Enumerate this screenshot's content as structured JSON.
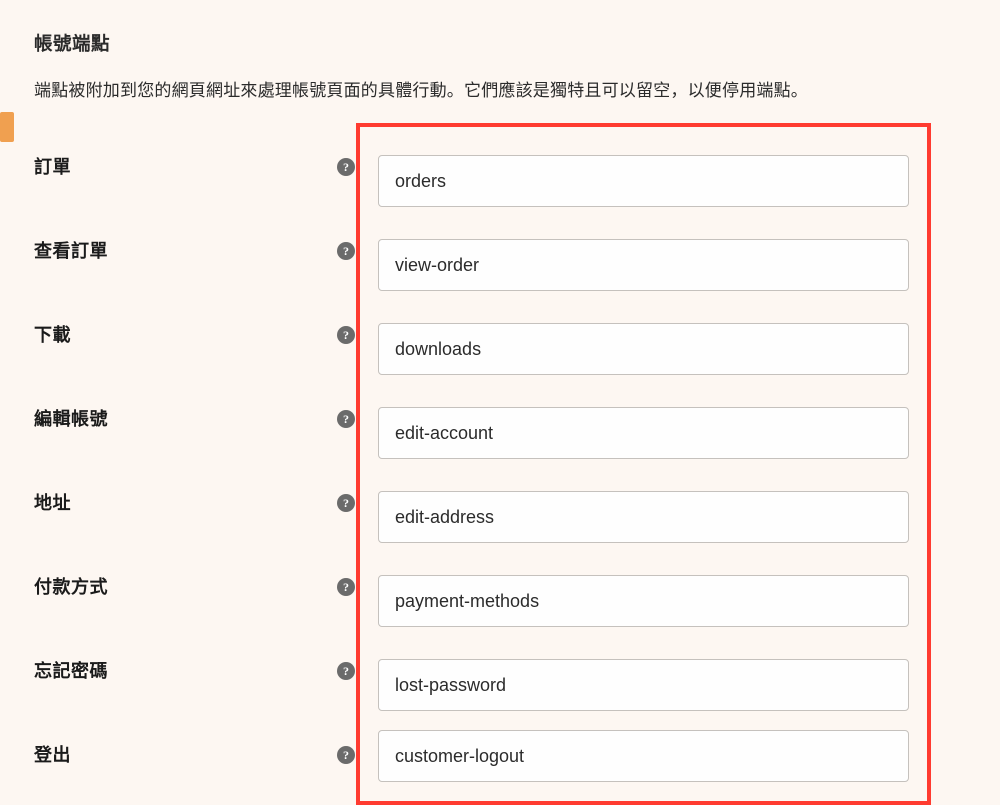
{
  "section": {
    "title": "帳號端點",
    "description": "端點被附加到您的網頁網址來處理帳號頁面的具體行動。它們應該是獨特且可以留空，以便停用端點。"
  },
  "helpGlyph": "?",
  "rows": [
    {
      "label": "訂單",
      "value": "orders",
      "name": "orders"
    },
    {
      "label": "查看訂單",
      "value": "view-order",
      "name": "view-order"
    },
    {
      "label": "下載",
      "value": "downloads",
      "name": "downloads"
    },
    {
      "label": "編輯帳號",
      "value": "edit-account",
      "name": "edit-account"
    },
    {
      "label": "地址",
      "value": "edit-address",
      "name": "edit-address"
    },
    {
      "label": "付款方式",
      "value": "payment-methods",
      "name": "payment-methods"
    },
    {
      "label": "忘記密碼",
      "value": "lost-password",
      "name": "lost-password"
    },
    {
      "label": "登出",
      "value": "customer-logout",
      "name": "customer-logout"
    }
  ]
}
